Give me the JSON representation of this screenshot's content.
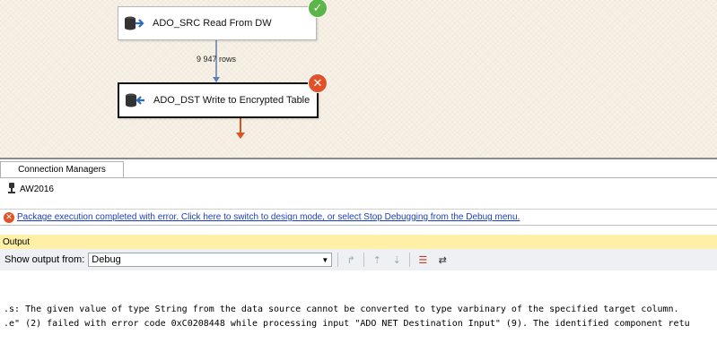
{
  "designer": {
    "source_task": {
      "label": "ADO_SRC Read From DW",
      "status": "success"
    },
    "dest_task": {
      "label": "ADO_DST Write to Encrypted Table",
      "status": "error"
    },
    "path_label": "9 947 rows",
    "colors": {
      "success": "#5bb548",
      "error": "#e0532a",
      "path": "#5b7fb3",
      "error_path": "#d9541e"
    }
  },
  "connection_managers": {
    "tab_label": "Connection Managers",
    "items": [
      {
        "label": "AW2016",
        "icon": "connection-plug-icon"
      }
    ]
  },
  "status_bar": {
    "text": "Package execution completed with error. Click here to switch to design mode, or select Stop Debugging from the Debug menu."
  },
  "output": {
    "title": "Output",
    "show_from_label": "Show output from:",
    "show_from_value": "Debug",
    "lines": [
      ".s: The given value of type String from the data source cannot be converted to type varbinary of the specified target column.",
      ".e\" (2) failed with error code 0xC0208448 while processing input \"ADO NET Destination Input\" (9). The identified component retu"
    ]
  }
}
